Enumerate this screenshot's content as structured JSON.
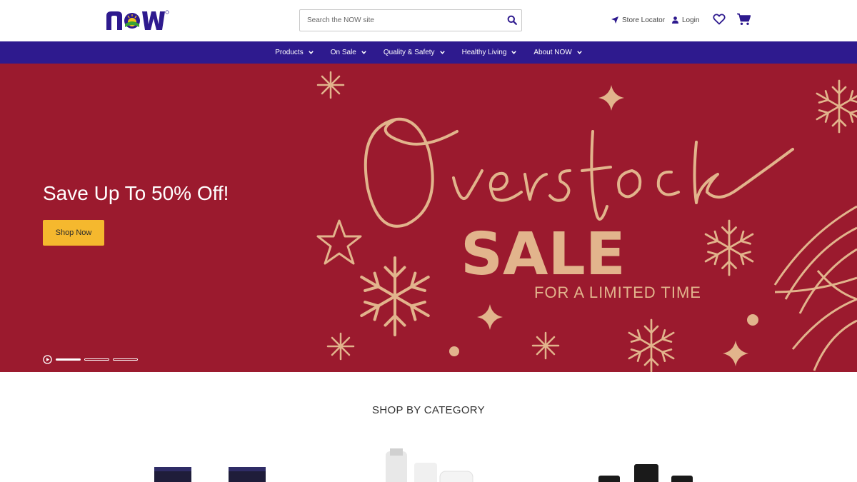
{
  "header": {
    "logo_text": "NOW",
    "search_placeholder": "Search the NOW site",
    "store_locator": "Store Locator",
    "login": "Login",
    "brand_color": "#2e1a8e",
    "icons": [
      "navigation-arrow-icon",
      "user-icon",
      "heart-icon",
      "cart-icon",
      "search-icon"
    ]
  },
  "nav": {
    "items": [
      {
        "label": "Products"
      },
      {
        "label": "On Sale"
      },
      {
        "label": "Quality & Safety"
      },
      {
        "label": "Healthy Living"
      },
      {
        "label": "About NOW"
      }
    ]
  },
  "hero": {
    "headline": "Save Up To 50% Off!",
    "cta": "Shop Now",
    "script_title": "Overstock",
    "sale": "SALE",
    "subtitle": "FOR A LIMITED TIME",
    "background_color": "#9b1a2e",
    "accent_color": "#e2b48c",
    "cta_color": "#f5b82e",
    "slides": 3,
    "active_slide": 1
  },
  "categories": {
    "title": "SHOP BY CATEGORY"
  }
}
